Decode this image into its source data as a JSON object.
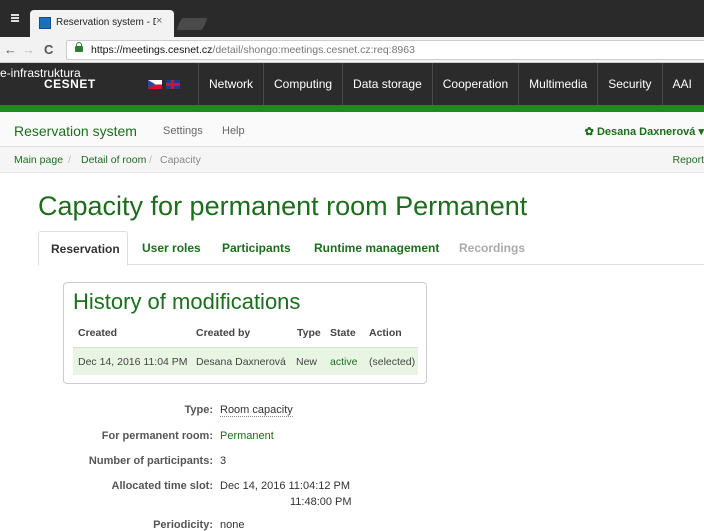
{
  "browser": {
    "tab_title": "Reservation system - Des",
    "url_host": "https://meetings.cesnet.cz",
    "url_path": "/detail/shongo:meetings.cesnet.cz:req:8963"
  },
  "cesnet": {
    "logo_line1": "e-infrastruktura",
    "logo_line2": "CESNET",
    "nav": [
      "Network",
      "Computing",
      "Data storage",
      "Cooperation",
      "Multimedia",
      "Security",
      "AAI"
    ]
  },
  "appnav": {
    "brand": "Reservation system",
    "settings": "Settings",
    "help": "Help",
    "user": "Desana Daxnerová"
  },
  "breadcrumb": {
    "items": [
      "Main page",
      "Detail of room",
      "Capacity"
    ],
    "report": "Report"
  },
  "page": {
    "title": "Capacity for permanent room Permanent",
    "tabs": [
      "Reservation",
      "User roles",
      "Participants",
      "Runtime management",
      "Recordings"
    ]
  },
  "history": {
    "title": "History of modifications",
    "columns": [
      "Created",
      "Created by",
      "Type",
      "State",
      "Action"
    ],
    "rows": [
      {
        "created": "Dec 14, 2016 11:04 PM",
        "by": "Desana Daxnerová",
        "type": "New",
        "state": "active",
        "action": "(selected)"
      }
    ]
  },
  "details": {
    "type_label": "Type:",
    "type_value": "Room capacity",
    "room_label": "For permanent room:",
    "room_value": "Permanent",
    "participants_label": "Number of participants:",
    "participants_value": "3",
    "slot_label": "Allocated time slot:",
    "slot_start": "Dec 14, 2016 11:04:12 PM",
    "slot_end": "11:48:00 PM",
    "periodicity_label": "Periodicity:",
    "periodicity_value": "none"
  }
}
